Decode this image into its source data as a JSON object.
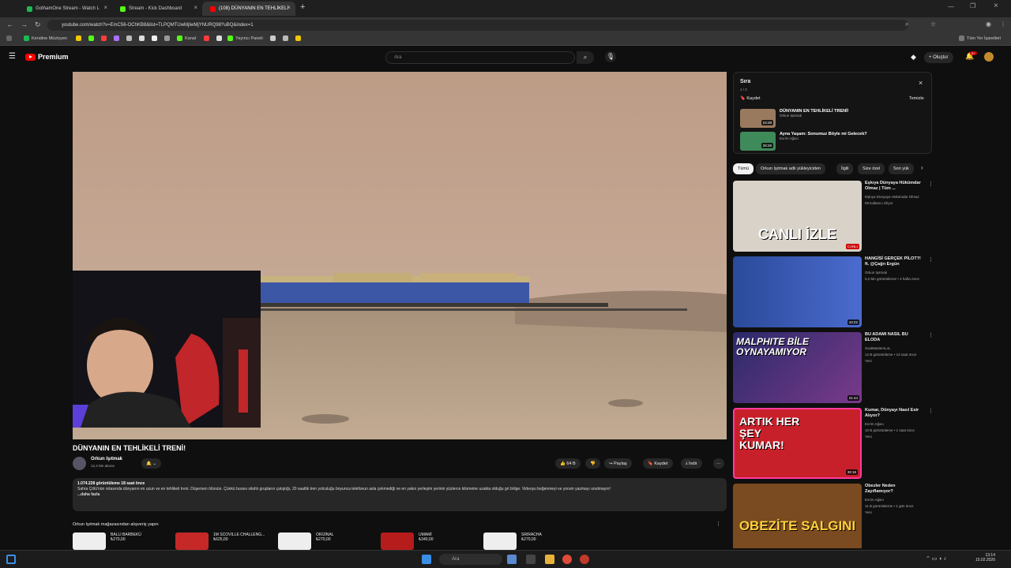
{
  "browser": {
    "tabs": [
      {
        "label": "GothamOne Stream - Watch L",
        "color": "#1db954"
      },
      {
        "label": "Stream - Kick Dashboard",
        "color": "#53fc18"
      },
      {
        "label": "(108) DÜNYANIN EN TEHLİKELİ",
        "color": "#ff0000"
      }
    ],
    "url": "youtube.com/watch?v=EmC56-OChKB8&list=TLPQMTUwMjIwMjYNURQ98?uBQ&index=1",
    "bookmarks": [
      "Kendine Müzisyen",
      "Kanal",
      "Yayıncı Paneli"
    ],
    "bookmarks_right": "Tüm Yer İşaretleri"
  },
  "yt": {
    "logo_text": "Premium",
    "search_placeholder": "Ara",
    "create_label": "Oluştur",
    "notif_count": "9+"
  },
  "video": {
    "title": "DÜNYANIN EN TEHLİKELİ TRENİ!",
    "channel": "Orkun Işıtmak",
    "subs": "12,4 Mn abone",
    "likes": "64 B",
    "share": "Paylaş",
    "save": "Kaydet",
    "download": "İndir",
    "views_line": "1.074.228 görüntüleme  18 saat önce",
    "description": "Sahra Çölü'nün ortasında dünyanın en uzun ve en tehlikeli treni. Düşersen ölürsün. Çünkü burası silahlı grupların çatıştığı, 20 saatlik tren yolculuğu boyunca telefonun asla çekmediği ve en yakın yerleşim yerinin yüzlerce kilometre uzakta olduğu gri bölge. Videoyu beğenmeyi ve yorum yazmayı unutmayın!",
    "more": "...daha fazla"
  },
  "shop": {
    "title": "Orkun Işıtmak mağazasından alışveriş yapın",
    "products": [
      {
        "name": "BALLI BARBEKÜ",
        "price": "₺270,00"
      },
      {
        "name": "1M SCOVILLE CHALLENG...",
        "price": "₺625,00"
      },
      {
        "name": "ORİJİNAL",
        "price": "₺270,00"
      },
      {
        "name": "UMAMİ",
        "price": "₺340,00"
      },
      {
        "name": "SRIRACHA",
        "price": "₺270,00"
      }
    ]
  },
  "queue": {
    "title": "Sıra",
    "count": "1 / 2",
    "save": "Kaydet",
    "clear": "Temizle",
    "items": [
      {
        "title": "DÜNYANIN EN TEHLİKELİ TRENİ!",
        "channel": "Orkun Işıtmak",
        "duration": "24:28"
      },
      {
        "title": "Ayna Yaşam: Sonumuz Böyle mi Gelecek?",
        "channel": "Evrim Ağacı",
        "duration": "28:26"
      }
    ]
  },
  "chips": [
    "Tümü",
    "Orkun Işıtmak adlı yükleyiciden",
    "İlgili",
    "Size özel",
    "Son yük"
  ],
  "recommendations": [
    {
      "title": "Eşkıya Dünyaya Hükümdar Olmaz | Tüm ...",
      "channel": "Eşkıya Dünyaya Hükümdar Olmaz",
      "meta": "59 kullanıcı izliyor",
      "thumb_text": "CANLI İZLE",
      "badge": "CANLI"
    },
    {
      "title": "HANGİSİ GERÇEK PİLOT?! ft. @Çağrı Ergün",
      "channel": "Orkun Işıtmak",
      "meta": "5,2 Mn görüntüleme • 4 hafta önce",
      "duration": "43:22"
    },
    {
      "title": "BU ADAMI NASIL BU ELODA",
      "channel": "SoulMastersLoL",
      "meta": "12 B görüntüleme • 13 saat önce",
      "thumb_text": "MALPHITE BİLE OYNAYAMIYOR",
      "duration": "21:44",
      "tag": "Yeni"
    },
    {
      "title": "Kumar, Dünyayı Nasıl Esir Alıyor?",
      "channel": "Evrim Ağacı",
      "meta": "10 B görüntüleme • 1 saat önce",
      "thumb_text": "ARTIK HER ŞEY KUMAR!",
      "duration": "38:18",
      "tag": "Yeni"
    },
    {
      "title": "Obezler Neden Zayıflamıyor?",
      "channel": "Evrim Ağacı",
      "meta": "11 B görüntüleme • 1 gün önce",
      "thumb_text": "OBEZİTE SALGINI",
      "tag": "Yeni"
    }
  ],
  "taskbar": {
    "search": "Ara",
    "time": "13:14",
    "date": "15.02.2026"
  }
}
